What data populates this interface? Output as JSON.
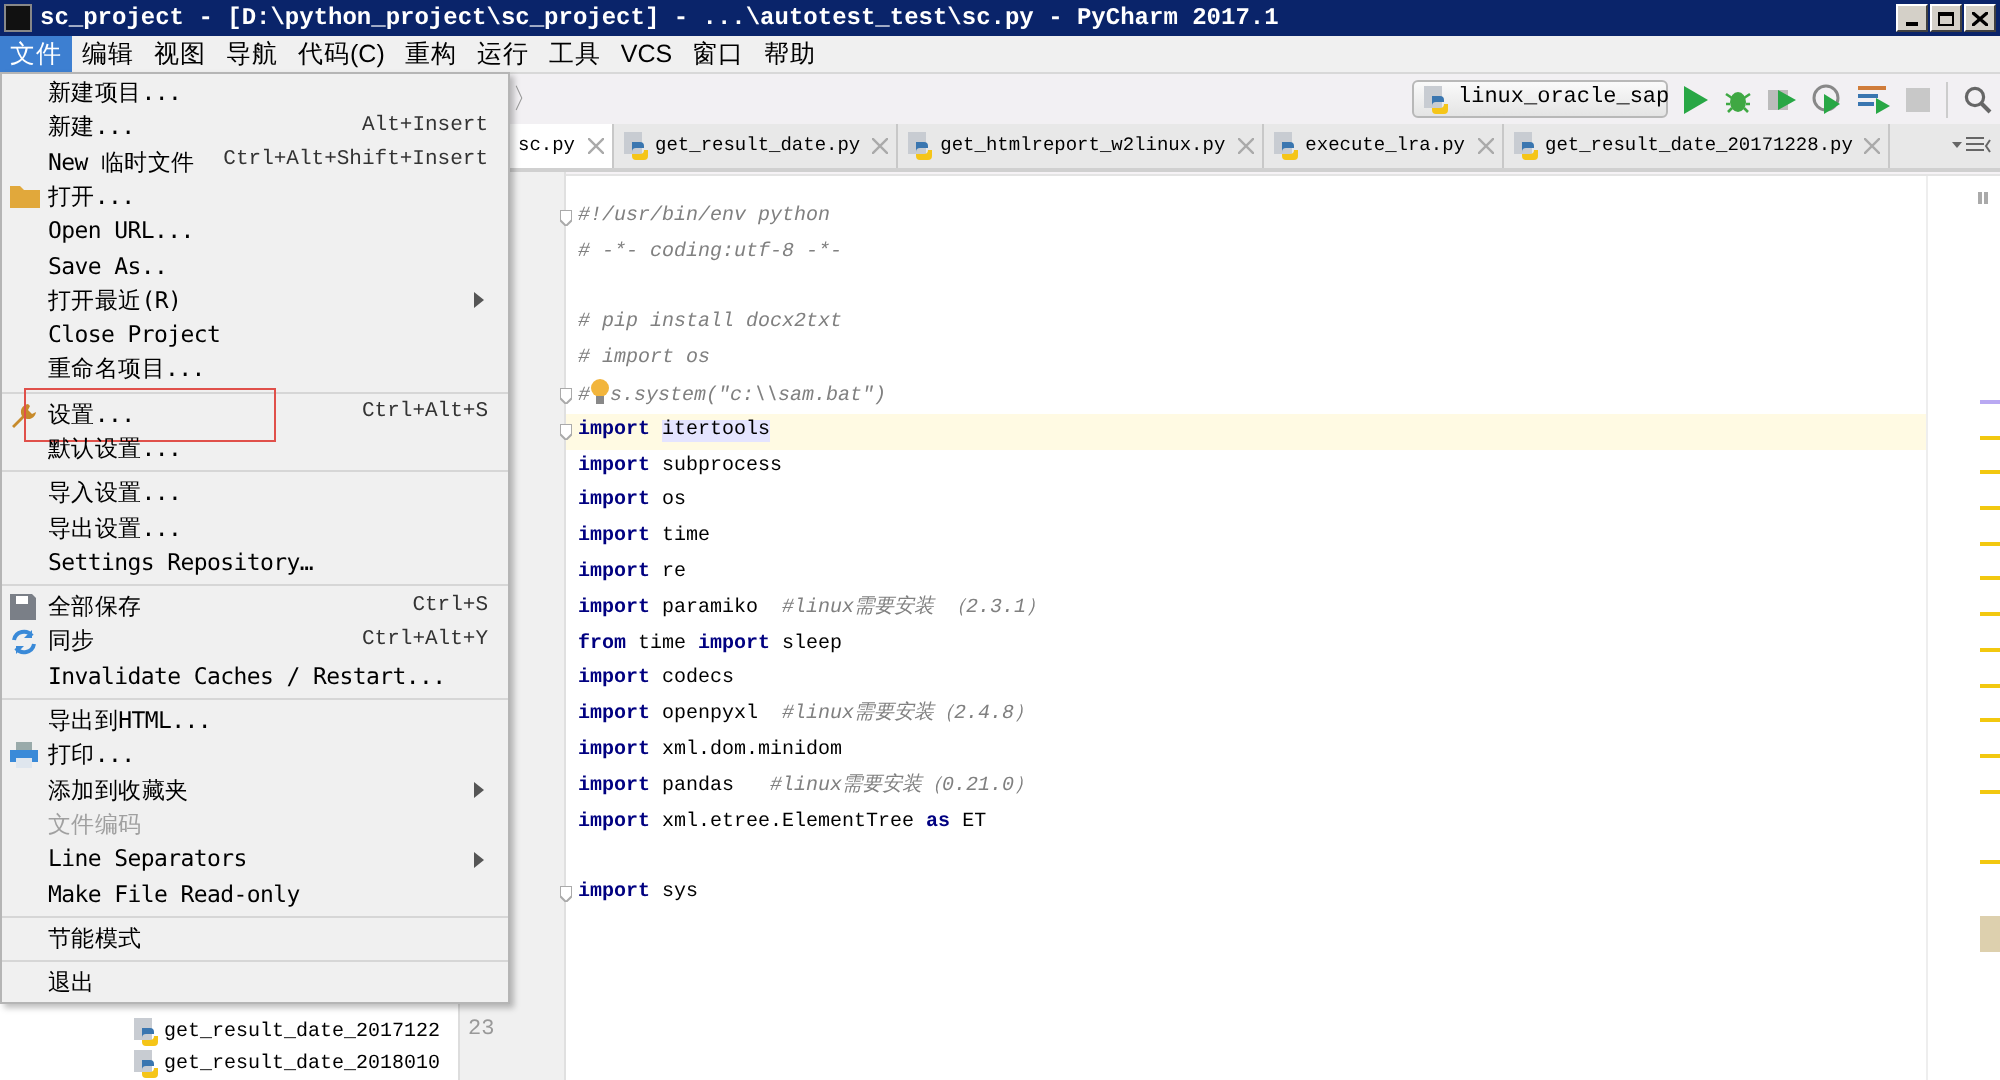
{
  "window": {
    "title": "sc_project - [D:\\python_project\\sc_project] - ...\\autotest_test\\sc.py - PyCharm 2017.1"
  },
  "menubar": [
    {
      "label": "文件",
      "selected": true
    },
    {
      "label": "编辑",
      "selected": false
    },
    {
      "label": "视图",
      "selected": false
    },
    {
      "label": "导航",
      "selected": false
    },
    {
      "label": "代码(C)",
      "selected": false
    },
    {
      "label": "重构",
      "selected": false
    },
    {
      "label": "运行",
      "selected": false
    },
    {
      "label": "工具",
      "selected": false
    },
    {
      "label": "VCS",
      "selected": false
    },
    {
      "label": "窗口",
      "selected": false
    },
    {
      "label": "帮助",
      "selected": false
    }
  ],
  "breadcrumb": {
    "separator": "〉"
  },
  "run_config": {
    "label": "linux_oracle_sap"
  },
  "tabs": [
    {
      "label": "sc.py",
      "selected": true
    },
    {
      "label": "get_result_date.py",
      "selected": false
    },
    {
      "label": "get_htmlreport_w2linux.py",
      "selected": false
    },
    {
      "label": "execute_lra.py",
      "selected": false
    },
    {
      "label": "get_result_date_20171228.py",
      "selected": false
    }
  ],
  "file_menu": {
    "groups": [
      [
        {
          "label": "新建项目...",
          "disabled": false,
          "outlined": false
        },
        {
          "label": "新建...",
          "shortcut": "Alt+Insert",
          "disabled": false,
          "outlined": false
        },
        {
          "label": "New 临时文件",
          "shortcut": "Ctrl+Alt+Shift+Insert",
          "disabled": false,
          "outlined": false
        },
        {
          "label": "打开...",
          "kind": "folder",
          "disabled": false,
          "outlined": false
        },
        {
          "label": "Open URL...",
          "disabled": false,
          "outlined": false
        },
        {
          "label": "Save As..",
          "disabled": false,
          "outlined": false
        },
        {
          "label": "打开最近(R)",
          "submenu": true,
          "disabled": false,
          "outlined": false
        },
        {
          "label": "Close Project",
          "disabled": false,
          "outlined": false
        },
        {
          "label": "重命名项目...",
          "disabled": false,
          "outlined": false
        }
      ],
      [
        {
          "label": "设置...",
          "shortcut": "Ctrl+Alt+S",
          "kind": "wrench",
          "disabled": false,
          "outlined": true
        },
        {
          "label": "默认设置...",
          "disabled": false,
          "outlined": false
        }
      ],
      [
        {
          "label": "导入设置...",
          "disabled": false,
          "outlined": false
        },
        {
          "label": "导出设置...",
          "disabled": false,
          "outlined": false
        },
        {
          "label": "Settings Repository…",
          "disabled": false,
          "outlined": false
        }
      ],
      [
        {
          "label": "全部保存",
          "shortcut": "Ctrl+S",
          "kind": "save",
          "disabled": false,
          "outlined": false
        },
        {
          "label": "同步",
          "shortcut": "Ctrl+Alt+Y",
          "kind": "sync",
          "disabled": false,
          "outlined": false
        },
        {
          "label": "Invalidate Caches / Restart...",
          "disabled": false,
          "outlined": false
        }
      ],
      [
        {
          "label": "导出到HTML...",
          "disabled": false,
          "outlined": false
        },
        {
          "label": "打印...",
          "kind": "print",
          "disabled": false,
          "outlined": false
        },
        {
          "label": "添加到收藏夹",
          "submenu": true,
          "disabled": false,
          "outlined": false
        },
        {
          "label": "文件编码",
          "disabled": true,
          "outlined": false
        },
        {
          "label": "Line Separators",
          "submenu": true,
          "disabled": false,
          "outlined": false
        },
        {
          "label": "Make File Read-only",
          "disabled": false,
          "outlined": false
        }
      ],
      [
        {
          "label": "节能模式",
          "disabled": false,
          "outlined": false
        }
      ],
      [
        {
          "label": "退出",
          "disabled": false,
          "outlined": false
        }
      ]
    ]
  },
  "project_tree": [
    {
      "label": "get_result_date_2017122"
    },
    {
      "label": "get_result_date_2018010"
    }
  ],
  "gutter": {
    "line_number": "23"
  },
  "code": [
    {
      "current": false,
      "fold": true,
      "tokens": [
        {
          "kind": "comment",
          "text": "#!/usr/bin/env python"
        }
      ]
    },
    {
      "current": false,
      "fold": false,
      "tokens": [
        {
          "kind": "comment",
          "text": "# -*- coding:utf-8 -*-"
        }
      ]
    },
    {
      "current": false,
      "fold": false
    },
    {
      "current": false,
      "fold": false,
      "tokens": [
        {
          "kind": "comment",
          "text": "# pip install docx2txt"
        }
      ]
    },
    {
      "current": false,
      "fold": false,
      "tokens": [
        {
          "kind": "comment",
          "text": "# import os"
        }
      ]
    },
    {
      "current": false,
      "fold": true,
      "tokens": [
        {
          "kind": "comment",
          "text": "#"
        },
        {
          "kind": "bulb"
        },
        {
          "kind": "comment",
          "text": "s.system(\"c:\\\\sam.bat\")"
        }
      ]
    },
    {
      "current": true,
      "fold": true,
      "tokens": [
        {
          "kind": "keyword",
          "text": "import "
        },
        {
          "kind": "highlight",
          "text": "itertools"
        }
      ]
    },
    {
      "current": false,
      "fold": false,
      "tokens": [
        {
          "kind": "keyword",
          "text": "import"
        },
        {
          "kind": "plain",
          "text": " subprocess"
        }
      ]
    },
    {
      "current": false,
      "fold": false,
      "tokens": [
        {
          "kind": "keyword",
          "text": "import"
        },
        {
          "kind": "plain",
          "text": " os"
        }
      ]
    },
    {
      "current": false,
      "fold": false,
      "tokens": [
        {
          "kind": "keyword",
          "text": "import"
        },
        {
          "kind": "plain",
          "text": " time"
        }
      ]
    },
    {
      "current": false,
      "fold": false,
      "tokens": [
        {
          "kind": "keyword",
          "text": "import"
        },
        {
          "kind": "plain",
          "text": " re"
        }
      ]
    },
    {
      "current": false,
      "fold": false,
      "tokens": [
        {
          "kind": "keyword",
          "text": "import"
        },
        {
          "kind": "plain",
          "text": " paramiko  "
        },
        {
          "kind": "comment",
          "text": "#linux需要安装 （2.3.1）"
        }
      ]
    },
    {
      "current": false,
      "fold": false,
      "tokens": [
        {
          "kind": "keyword",
          "text": "from"
        },
        {
          "kind": "plain",
          "text": " time "
        },
        {
          "kind": "keyword",
          "text": "import"
        },
        {
          "kind": "plain",
          "text": " sleep"
        }
      ]
    },
    {
      "current": false,
      "fold": false,
      "tokens": [
        {
          "kind": "keyword",
          "text": "import"
        },
        {
          "kind": "plain",
          "text": " codecs"
        }
      ]
    },
    {
      "current": false,
      "fold": false,
      "tokens": [
        {
          "kind": "keyword",
          "text": "import"
        },
        {
          "kind": "plain",
          "text": " openpyxl  "
        },
        {
          "kind": "comment",
          "text": "#linux需要安装（2.4.8）"
        }
      ]
    },
    {
      "current": false,
      "fold": false,
      "tokens": [
        {
          "kind": "keyword",
          "text": "import"
        },
        {
          "kind": "plain",
          "text": " xml.dom.minidom"
        }
      ]
    },
    {
      "current": false,
      "fold": false,
      "tokens": [
        {
          "kind": "keyword",
          "text": "import"
        },
        {
          "kind": "plain",
          "text": " pandas   "
        },
        {
          "kind": "comment",
          "text": "#linux需要安装（0.21.0）"
        }
      ]
    },
    {
      "current": false,
      "fold": false,
      "tokens": [
        {
          "kind": "keyword",
          "text": "import"
        },
        {
          "kind": "plain",
          "text": " xml.etree.ElementTree "
        },
        {
          "kind": "keyword",
          "text": "as"
        },
        {
          "kind": "plain",
          "text": " ET"
        }
      ]
    },
    {
      "current": false,
      "fold": false
    },
    {
      "current": false,
      "fold": true,
      "tokens": [
        {
          "kind": "keyword",
          "text": "import"
        },
        {
          "kind": "plain",
          "text": " sys"
        }
      ]
    }
  ]
}
